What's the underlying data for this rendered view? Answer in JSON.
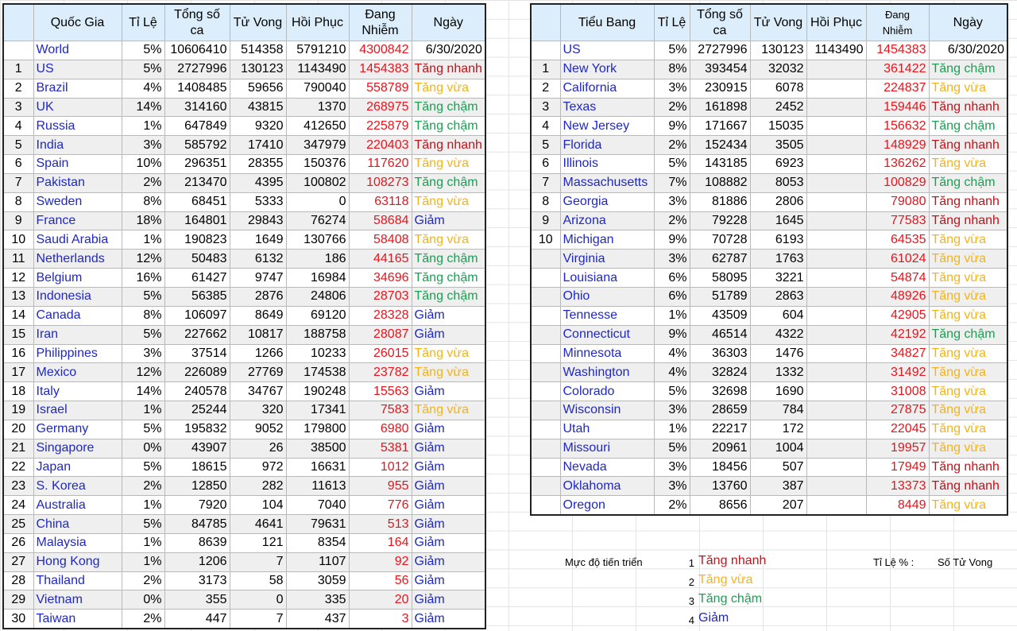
{
  "countries": {
    "headers": {
      "idx": "",
      "name": "Quốc Gia",
      "rate": "Tỉ Lệ",
      "total": "Tổng số ca",
      "deaths": "Tử Vong",
      "recovered": "Hồi Phục",
      "active": "Đang Nhiễm",
      "date": "Ngày"
    },
    "world": {
      "idx": "",
      "name": "World",
      "rate": "5%",
      "total": "10606410",
      "deaths": "514358",
      "recovered": "5791210",
      "active": "4300842",
      "date": "6/30/2020"
    },
    "rows": [
      {
        "idx": "1",
        "name": "US",
        "rate": "5%",
        "total": "2727996",
        "deaths": "130123",
        "recovered": "1143490",
        "active": "1454383",
        "trend": "Tăng nhanh",
        "cls": "t-fast"
      },
      {
        "idx": "2",
        "name": "Brazil",
        "rate": "4%",
        "total": "1408485",
        "deaths": "59656",
        "recovered": "790040",
        "active": "558789",
        "trend": "Tăng vừa",
        "cls": "t-mid"
      },
      {
        "idx": "3",
        "name": "UK",
        "rate": "14%",
        "total": "314160",
        "deaths": "43815",
        "recovered": "1370",
        "active": "268975",
        "trend": "Tăng chậm",
        "cls": "t-slow"
      },
      {
        "idx": "4",
        "name": "Russia",
        "rate": "1%",
        "total": "647849",
        "deaths": "9320",
        "recovered": "412650",
        "active": "225879",
        "trend": "Tăng chậm",
        "cls": "t-slow"
      },
      {
        "idx": "5",
        "name": "India",
        "rate": "3%",
        "total": "585792",
        "deaths": "17410",
        "recovered": "347979",
        "active": "220403",
        "trend": "Tăng nhanh",
        "cls": "t-fast"
      },
      {
        "idx": "6",
        "name": "Spain",
        "rate": "10%",
        "total": "296351",
        "deaths": "28355",
        "recovered": "150376",
        "active": "117620",
        "trend": "Tăng vừa",
        "cls": "t-mid"
      },
      {
        "idx": "7",
        "name": "Pakistan",
        "rate": "2%",
        "total": "213470",
        "deaths": "4395",
        "recovered": "100802",
        "active": "108273",
        "trend": "Tăng chậm",
        "cls": "t-slow"
      },
      {
        "idx": "8",
        "name": "Sweden",
        "rate": "8%",
        "total": "68451",
        "deaths": "5333",
        "recovered": "0",
        "active": "63118",
        "trend": "Tăng vừa",
        "cls": "t-mid"
      },
      {
        "idx": "9",
        "name": "France",
        "rate": "18%",
        "total": "164801",
        "deaths": "29843",
        "recovered": "76274",
        "active": "58684",
        "trend": "Giảm",
        "cls": "t-dec"
      },
      {
        "idx": "10",
        "name": "Saudi Arabia",
        "rate": "1%",
        "total": "190823",
        "deaths": "1649",
        "recovered": "130766",
        "active": "58408",
        "trend": "Tăng vừa",
        "cls": "t-mid"
      },
      {
        "idx": "11",
        "name": "Netherlands",
        "rate": "12%",
        "total": "50483",
        "deaths": "6132",
        "recovered": "186",
        "active": "44165",
        "trend": "Tăng chậm",
        "cls": "t-slow"
      },
      {
        "idx": "12",
        "name": "Belgium",
        "rate": "16%",
        "total": "61427",
        "deaths": "9747",
        "recovered": "16984",
        "active": "34696",
        "trend": "Tăng chậm",
        "cls": "t-slow"
      },
      {
        "idx": "13",
        "name": "Indonesia",
        "rate": "5%",
        "total": "56385",
        "deaths": "2876",
        "recovered": "24806",
        "active": "28703",
        "trend": "Tăng chậm",
        "cls": "t-slow"
      },
      {
        "idx": "14",
        "name": "Canada",
        "rate": "8%",
        "total": "106097",
        "deaths": "8649",
        "recovered": "69120",
        "active": "28328",
        "trend": "Giảm",
        "cls": "t-dec"
      },
      {
        "idx": "15",
        "name": "Iran",
        "rate": "5%",
        "total": "227662",
        "deaths": "10817",
        "recovered": "188758",
        "active": "28087",
        "trend": "Giảm",
        "cls": "t-dec"
      },
      {
        "idx": "16",
        "name": "Philippines",
        "rate": "3%",
        "total": "37514",
        "deaths": "1266",
        "recovered": "10233",
        "active": "26015",
        "trend": "Tăng vừa",
        "cls": "t-mid"
      },
      {
        "idx": "17",
        "name": "Mexico",
        "rate": "12%",
        "total": "226089",
        "deaths": "27769",
        "recovered": "174538",
        "active": "23782",
        "trend": "Tăng vừa",
        "cls": "t-mid"
      },
      {
        "idx": "18",
        "name": "Italy",
        "rate": "14%",
        "total": "240578",
        "deaths": "34767",
        "recovered": "190248",
        "active": "15563",
        "trend": "Giảm",
        "cls": "t-dec"
      },
      {
        "idx": "19",
        "name": "Israel",
        "rate": "1%",
        "total": "25244",
        "deaths": "320",
        "recovered": "17341",
        "active": "7583",
        "trend": "Tăng vừa",
        "cls": "t-mid"
      },
      {
        "idx": "20",
        "name": "Germany",
        "rate": "5%",
        "total": "195832",
        "deaths": "9052",
        "recovered": "179800",
        "active": "6980",
        "trend": "Giảm",
        "cls": "t-dec"
      },
      {
        "idx": "21",
        "name": "Singapore",
        "rate": "0%",
        "total": "43907",
        "deaths": "26",
        "recovered": "38500",
        "active": "5381",
        "trend": "Giảm",
        "cls": "t-dec"
      },
      {
        "idx": "22",
        "name": "Japan",
        "rate": "5%",
        "total": "18615",
        "deaths": "972",
        "recovered": "16631",
        "active": "1012",
        "trend": "Giảm",
        "cls": "t-dec"
      },
      {
        "idx": "23",
        "name": "S. Korea",
        "rate": "2%",
        "total": "12850",
        "deaths": "282",
        "recovered": "11613",
        "active": "955",
        "trend": "Giảm",
        "cls": "t-dec"
      },
      {
        "idx": "24",
        "name": "Australia",
        "rate": "1%",
        "total": "7920",
        "deaths": "104",
        "recovered": "7040",
        "active": "776",
        "trend": "Giảm",
        "cls": "t-dec"
      },
      {
        "idx": "25",
        "name": "China",
        "rate": "5%",
        "total": "84785",
        "deaths": "4641",
        "recovered": "79631",
        "active": "513",
        "trend": "Giảm",
        "cls": "t-dec"
      },
      {
        "idx": "26",
        "name": "Malaysia",
        "rate": "1%",
        "total": "8639",
        "deaths": "121",
        "recovered": "8354",
        "active": "164",
        "trend": "Giảm",
        "cls": "t-dec"
      },
      {
        "idx": "27",
        "name": "Hong Kong",
        "rate": "1%",
        "total": "1206",
        "deaths": "7",
        "recovered": "1107",
        "active": "92",
        "trend": "Giảm",
        "cls": "t-dec"
      },
      {
        "idx": "28",
        "name": "Thailand",
        "rate": "2%",
        "total": "3173",
        "deaths": "58",
        "recovered": "3059",
        "active": "56",
        "trend": "Giảm",
        "cls": "t-dec"
      },
      {
        "idx": "29",
        "name": "Vietnam",
        "rate": "0%",
        "total": "355",
        "deaths": "0",
        "recovered": "335",
        "active": "20",
        "trend": "Giảm",
        "cls": "t-dec"
      },
      {
        "idx": "30",
        "name": "Taiwan",
        "rate": "2%",
        "total": "447",
        "deaths": "7",
        "recovered": "437",
        "active": "3",
        "trend": "Giảm",
        "cls": "t-dec"
      }
    ]
  },
  "states": {
    "headers": {
      "idx": "",
      "name": "Tiểu Bang",
      "rate": "Tỉ Lệ",
      "total": "Tổng số ca",
      "deaths": "Tử Vong",
      "recovered": "Hồi Phục",
      "active": "Đang Nhiễm",
      "date": "Ngày"
    },
    "us": {
      "idx": "",
      "name": "US",
      "rate": "5%",
      "total": "2727996",
      "deaths": "130123",
      "recovered": "1143490",
      "active": "1454383",
      "date": "6/30/2020"
    },
    "rows": [
      {
        "idx": "1",
        "name": "New York",
        "rate": "8%",
        "total": "393454",
        "deaths": "32032",
        "recovered": "",
        "active": "361422",
        "trend": "Tăng chậm",
        "cls": "t-slow"
      },
      {
        "idx": "2",
        "name": "California",
        "rate": "3%",
        "total": "230915",
        "deaths": "6078",
        "recovered": "",
        "active": "224837",
        "trend": "Tăng vừa",
        "cls": "t-mid"
      },
      {
        "idx": "3",
        "name": "Texas",
        "rate": "2%",
        "total": "161898",
        "deaths": "2452",
        "recovered": "",
        "active": "159446",
        "trend": "Tăng nhanh",
        "cls": "t-fast"
      },
      {
        "idx": "4",
        "name": "New Jersey",
        "rate": "9%",
        "total": "171667",
        "deaths": "15035",
        "recovered": "",
        "active": "156632",
        "trend": "Tăng chậm",
        "cls": "t-slow"
      },
      {
        "idx": "5",
        "name": "Florida",
        "rate": "2%",
        "total": "152434",
        "deaths": "3505",
        "recovered": "",
        "active": "148929",
        "trend": "Tăng nhanh",
        "cls": "t-fast"
      },
      {
        "idx": "6",
        "name": "Illinois",
        "rate": "5%",
        "total": "143185",
        "deaths": "6923",
        "recovered": "",
        "active": "136262",
        "trend": "Tăng vừa",
        "cls": "t-mid"
      },
      {
        "idx": "7",
        "name": "Massachusetts",
        "rate": "7%",
        "total": "108882",
        "deaths": "8053",
        "recovered": "",
        "active": "100829",
        "trend": "Tăng chậm",
        "cls": "t-slow"
      },
      {
        "idx": "8",
        "name": "Georgia",
        "rate": "3%",
        "total": "81886",
        "deaths": "2806",
        "recovered": "",
        "active": "79080",
        "trend": "Tăng nhanh",
        "cls": "t-fast"
      },
      {
        "idx": "9",
        "name": "Arizona",
        "rate": "2%",
        "total": "79228",
        "deaths": "1645",
        "recovered": "",
        "active": "77583",
        "trend": "Tăng nhanh",
        "cls": "t-fast"
      },
      {
        "idx": "10",
        "name": "Michigan",
        "rate": "9%",
        "total": "70728",
        "deaths": "6193",
        "recovered": "",
        "active": "64535",
        "trend": "Tăng vừa",
        "cls": "t-mid"
      },
      {
        "idx": "",
        "name": "Virginia",
        "rate": "3%",
        "total": "62787",
        "deaths": "1763",
        "recovered": "",
        "active": "61024",
        "trend": "Tăng vừa",
        "cls": "t-mid"
      },
      {
        "idx": "",
        "name": "Louisiana",
        "rate": "6%",
        "total": "58095",
        "deaths": "3221",
        "recovered": "",
        "active": "54874",
        "trend": "Tăng vừa",
        "cls": "t-mid"
      },
      {
        "idx": "",
        "name": "Ohio",
        "rate": "6%",
        "total": "51789",
        "deaths": "2863",
        "recovered": "",
        "active": "48926",
        "trend": "Tăng vừa",
        "cls": "t-mid"
      },
      {
        "idx": "",
        "name": "Tennesse",
        "rate": "1%",
        "total": "43509",
        "deaths": "604",
        "recovered": "",
        "active": "42905",
        "trend": "Tăng vừa",
        "cls": "t-mid"
      },
      {
        "idx": "",
        "name": "Connecticut",
        "rate": "9%",
        "total": "46514",
        "deaths": "4322",
        "recovered": "",
        "active": "42192",
        "trend": "Tăng chậm",
        "cls": "t-slow"
      },
      {
        "idx": "",
        "name": "Minnesota",
        "rate": "4%",
        "total": "36303",
        "deaths": "1476",
        "recovered": "",
        "active": "34827",
        "trend": "Tăng vừa",
        "cls": "t-mid"
      },
      {
        "idx": "",
        "name": "Washington",
        "rate": "4%",
        "total": "32824",
        "deaths": "1332",
        "recovered": "",
        "active": "31492",
        "trend": "Tăng vừa",
        "cls": "t-mid"
      },
      {
        "idx": "",
        "name": "Colorado",
        "rate": "5%",
        "total": "32698",
        "deaths": "1690",
        "recovered": "",
        "active": "31008",
        "trend": "Tăng vừa",
        "cls": "t-mid"
      },
      {
        "idx": "",
        "name": "Wisconsin",
        "rate": "3%",
        "total": "28659",
        "deaths": "784",
        "recovered": "",
        "active": "27875",
        "trend": "Tăng vừa",
        "cls": "t-mid"
      },
      {
        "idx": "",
        "name": "Utah",
        "rate": "1%",
        "total": "22217",
        "deaths": "172",
        "recovered": "",
        "active": "22045",
        "trend": "Tăng vừa",
        "cls": "t-mid"
      },
      {
        "idx": "",
        "name": "Missouri",
        "rate": "5%",
        "total": "20961",
        "deaths": "1004",
        "recovered": "",
        "active": "19957",
        "trend": "Tăng vừa",
        "cls": "t-mid"
      },
      {
        "idx": "",
        "name": "Nevada",
        "rate": "3%",
        "total": "18456",
        "deaths": "507",
        "recovered": "",
        "active": "17949",
        "trend": "Tăng nhanh",
        "cls": "t-fast"
      },
      {
        "idx": "",
        "name": "Oklahoma",
        "rate": "3%",
        "total": "13760",
        "deaths": "387",
        "recovered": "",
        "active": "13373",
        "trend": "Tăng nhanh",
        "cls": "t-fast"
      },
      {
        "idx": "",
        "name": "Oregon",
        "rate": "2%",
        "total": "8656",
        "deaths": "207",
        "recovered": "",
        "active": "8449",
        "trend": "Tăng vừa",
        "cls": "t-mid"
      }
    ]
  },
  "legend": {
    "title": "Mực độ tiến triển",
    "items": [
      {
        "num": "1",
        "label": "Tăng nhanh",
        "cls": "t-fast"
      },
      {
        "num": "2",
        "label": "Tăng vừa",
        "cls": "t-mid"
      },
      {
        "num": "3",
        "label": "Tăng chậm",
        "cls": "t-slow"
      },
      {
        "num": "4",
        "label": "Giảm",
        "cls": "t-dec"
      }
    ],
    "rate_label": "Tỉ Lệ % :",
    "deaths_label": "Số Tử Vong"
  },
  "colors": {
    "header_bg": "#dceefb",
    "name_text": "#1f28c4",
    "active_text": "#e8141b",
    "trend_fast": "#c0141b",
    "trend_mid": "#f3b31b",
    "trend_slow": "#1b9f52",
    "trend_decrease": "#1f28c4"
  }
}
